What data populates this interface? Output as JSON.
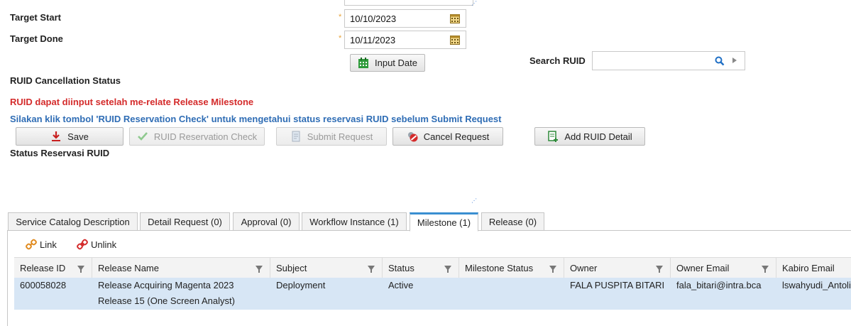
{
  "form": {
    "target_start": {
      "label": "Target Start",
      "value": "10/10/2023"
    },
    "target_done": {
      "label": "Target Done",
      "value": "10/11/2023"
    },
    "required_mark": "*",
    "input_date_button": "Input Date",
    "search_ruid_label": "Search RUID",
    "search_ruid_value": "",
    "ruid_cancellation_label": "RUID Cancellation Status",
    "warning_text": "RUID dapat diinput setelah me-relate Release Milestone",
    "info_text": "Silakan klik tombol 'RUID Reservation Check' untuk mengetahui status reservasi RUID sebelum Submit Request",
    "status_reservasi_label": "Status Reservasi RUID"
  },
  "actions": {
    "save": "Save",
    "ruid_reservation_check": "RUID Reservation Check",
    "submit_request": "Submit Request",
    "cancel_request": "Cancel Request",
    "add_ruid_detail": "Add RUID Detail"
  },
  "tabs": [
    {
      "label": "Service Catalog Description",
      "active": false
    },
    {
      "label": "Detail Request (0)",
      "active": false
    },
    {
      "label": "Approval (0)",
      "active": false
    },
    {
      "label": "Workflow Instance (1)",
      "active": false
    },
    {
      "label": "Milestone (1)",
      "active": true
    },
    {
      "label": "Release (0)",
      "active": false
    }
  ],
  "toolbar": {
    "link": "Link",
    "unlink": "Unlink"
  },
  "table": {
    "columns": [
      "Release ID",
      "Release Name",
      "Subject",
      "Status",
      "Milestone Status",
      "Owner",
      "Owner Email",
      "Kabiro Email"
    ],
    "rows": [
      {
        "release_id": "600058028",
        "release_name_line1": "Release Acquiring Magenta 2023",
        "release_name_line2": "Release 15 (One Screen Analyst)",
        "subject": "Deployment",
        "status": "Active",
        "milestone_status": "",
        "owner": "FALA PUSPITA BITARI",
        "owner_email": "fala_bitari@intra.bca",
        "kabiro_email": "lswahyudi_Antoli"
      }
    ]
  },
  "colors": {
    "accent": "#3a8fd1",
    "warning": "#d42b2b",
    "info": "#2f6db5",
    "row_selected": "#d7e6f5"
  }
}
